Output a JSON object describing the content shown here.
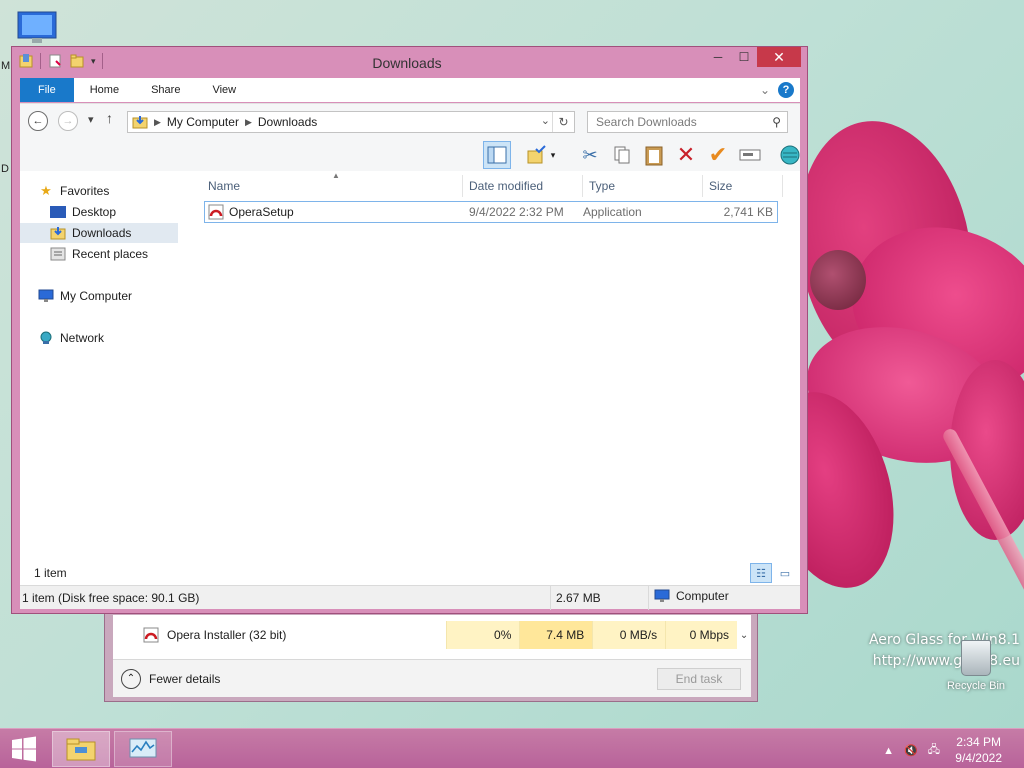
{
  "window": {
    "title": "Downloads",
    "minimize": "─",
    "maximize": "☐",
    "close": "✕"
  },
  "ribbon": {
    "tabs": [
      "File",
      "Home",
      "Share",
      "View"
    ],
    "expand": "⌄",
    "help": "?"
  },
  "address": {
    "path": [
      "My Computer",
      "Downloads"
    ],
    "search_placeholder": "Search Downloads"
  },
  "navpane": {
    "favorites": "Favorites",
    "desktop": "Desktop",
    "downloads": "Downloads",
    "recent": "Recent places",
    "computer": "My Computer",
    "network": "Network"
  },
  "columns": [
    "Name",
    "Date modified",
    "Type",
    "Size"
  ],
  "files": [
    {
      "name": "OperaSetup",
      "date": "9/4/2022 2:32 PM",
      "type": "Application",
      "size": "2,741 KB"
    }
  ],
  "status": {
    "count": "1 item",
    "details": "1 item (Disk free space: 90.1 GB)",
    "size": "2.67 MB",
    "location": "Computer"
  },
  "taskmanager": {
    "process": "Opera Installer (32 bit)",
    "cpu": "0%",
    "memory": "7.4 MB",
    "disk": "0 MB/s",
    "network": "0 Mbps",
    "fewer_details": "Fewer details",
    "end_task": "End task"
  },
  "desktop": {
    "watermark_line1": "Aero Glass for Win8.1",
    "watermark_line2": "http://www.glass8.eu",
    "recycle_bin": "Recycle Bin",
    "edge_letter_1": "M",
    "edge_letter_2": "D"
  },
  "taskbar": {
    "time": "2:34 PM",
    "date": "9/4/2022"
  },
  "colors": {
    "accent": "#1979ca",
    "window_frame": "#d88fb9",
    "taskbar": "#b8639a",
    "selection": "#cce4f7"
  }
}
